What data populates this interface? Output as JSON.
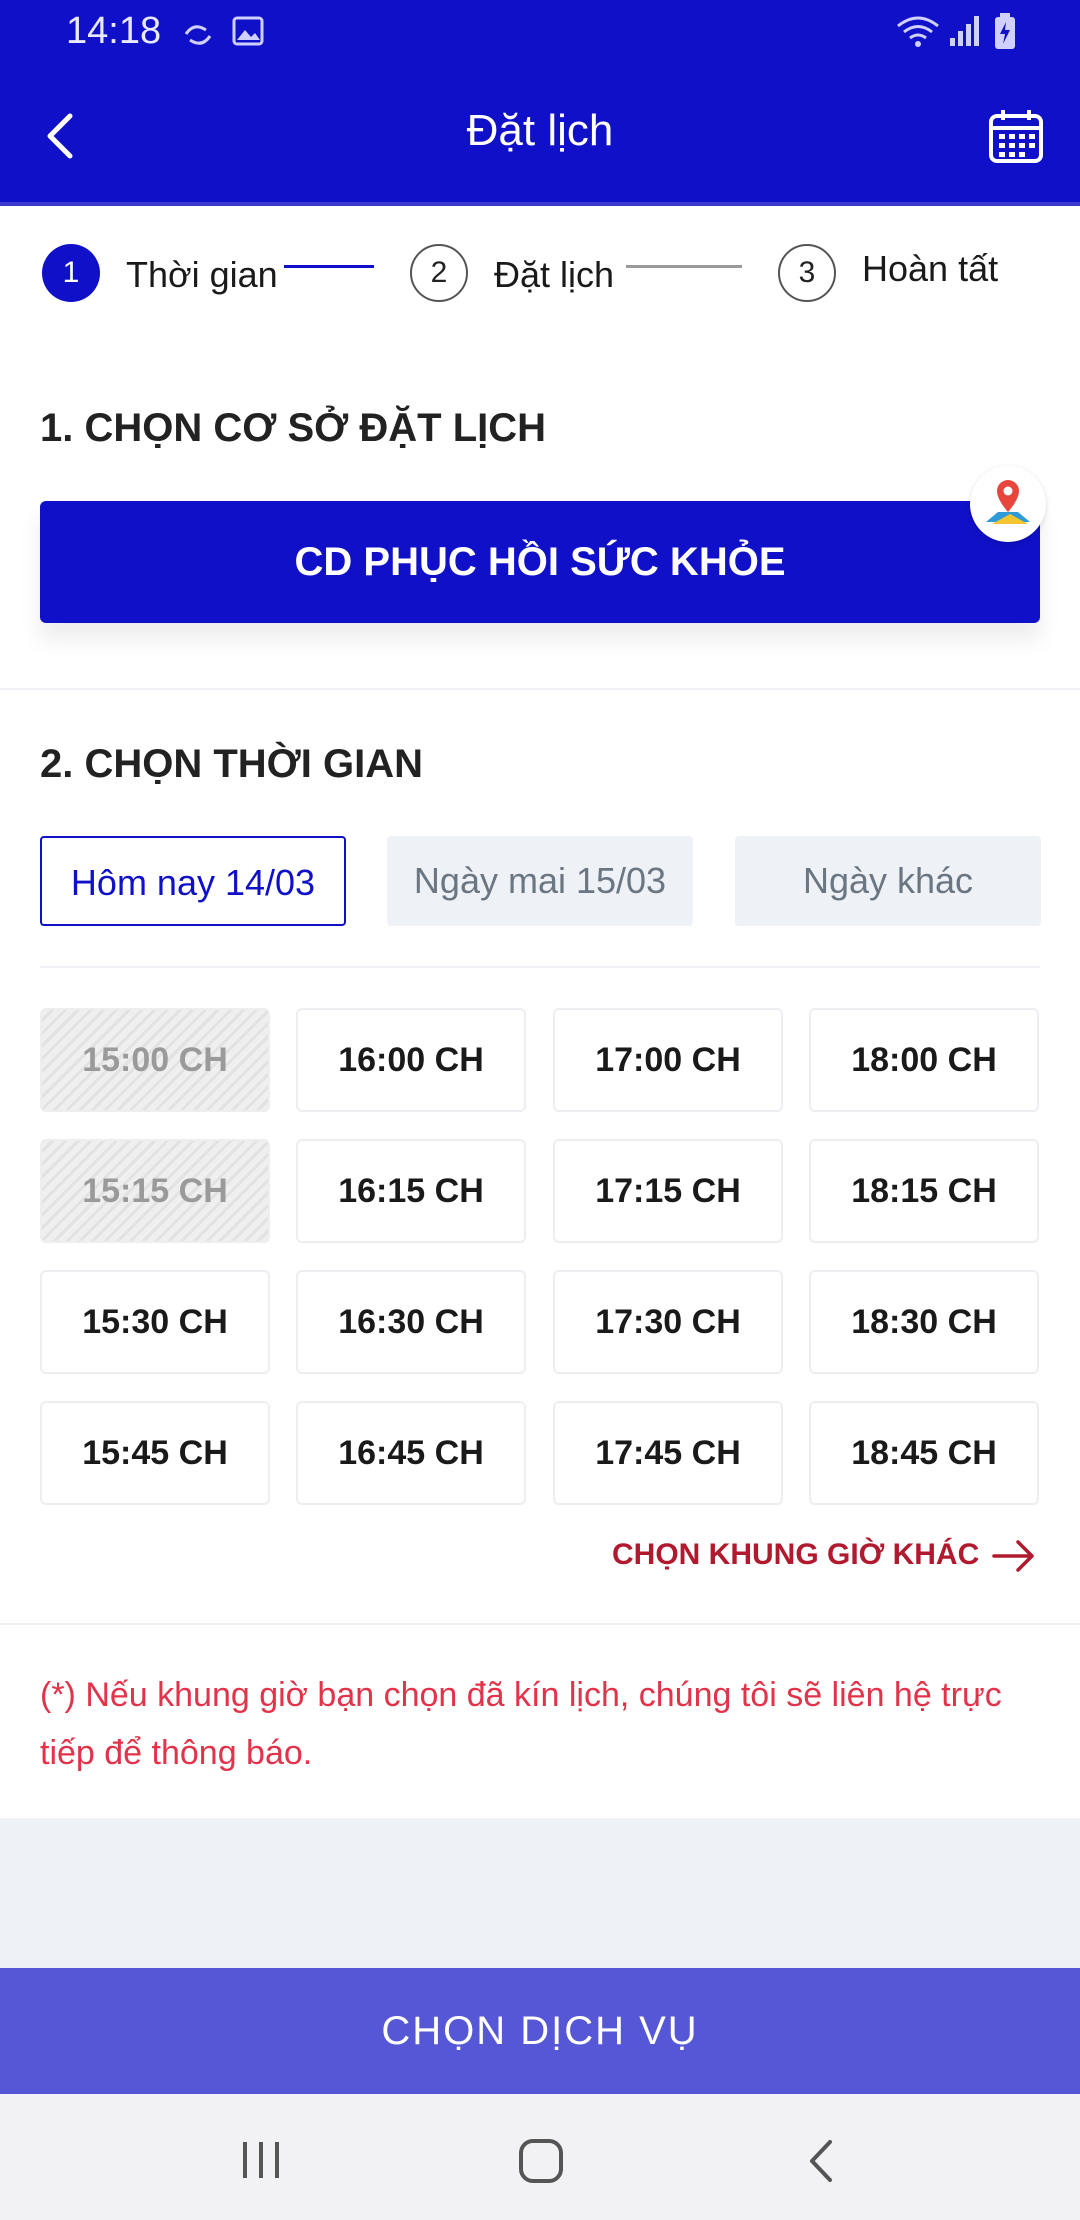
{
  "status_bar": {
    "time": "14:18"
  },
  "header": {
    "title": "Đặt lịch"
  },
  "stepper": {
    "steps": [
      {
        "number": "1",
        "label": "Thời gian"
      },
      {
        "number": "2",
        "label": "Đặt lịch"
      },
      {
        "number": "3",
        "label": "Hoàn tất"
      }
    ]
  },
  "section1": {
    "title": "1. CHỌN CƠ SỞ ĐẶT LỊCH",
    "facility": "CD PHỤC HỒI SỨC KHỎE"
  },
  "section2": {
    "title": "2. CHỌN THỜI GIAN",
    "days": [
      "Hôm nay 14/03",
      "Ngày mai 15/03",
      "Ngày khác"
    ],
    "slots": [
      [
        "15:00 CH",
        "16:00 CH",
        "17:00 CH",
        "18:00 CH"
      ],
      [
        "15:15 CH",
        "16:15 CH",
        "17:15 CH",
        "18:15 CH"
      ],
      [
        "15:30 CH",
        "16:30 CH",
        "17:30 CH",
        "18:30 CH"
      ],
      [
        "15:45 CH",
        "16:45 CH",
        "17:45 CH",
        "18:45 CH"
      ]
    ],
    "disabled_slots": [
      "15:00 CH",
      "15:15 CH"
    ],
    "other_slots_link": "CHỌN KHUNG GIỜ KHÁC"
  },
  "note": "(*) Nếu khung giờ bạn chọn đã kín lịch, chúng tôi sẽ liên hệ trực tiếp để thông báo.",
  "cta": {
    "label": "CHỌN DỊCH VỤ"
  },
  "colors": {
    "primary": "#1010c8",
    "cta": "#5557d6",
    "link": "#b11a2e",
    "note": "#e3334a"
  },
  "icons": [
    "back-arrow-icon",
    "calendar-icon",
    "map-pin-icon",
    "arrow-right-icon",
    "recent-apps-icon",
    "home-icon",
    "system-back-icon"
  ]
}
